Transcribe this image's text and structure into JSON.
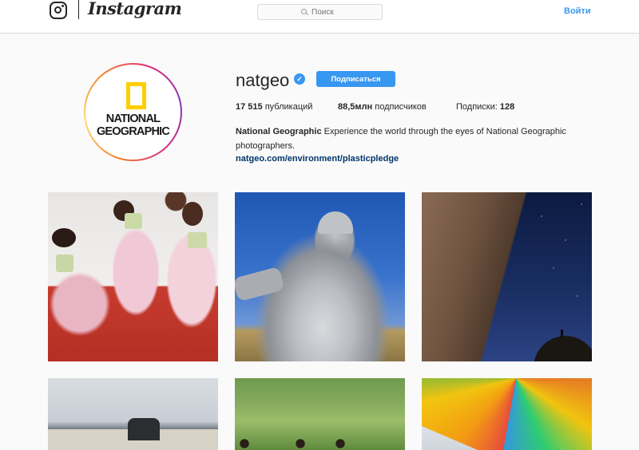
{
  "header": {
    "wordmark": "Instagram",
    "search_placeholder": "Поиск",
    "login_label": "Войти"
  },
  "profile": {
    "username": "natgeo",
    "verified_glyph": "✓",
    "follow_label": "Подписаться",
    "logo_line1": "NATIONAL",
    "logo_line2": "GEOGRAPHIC",
    "stats": {
      "posts_count": "17 515",
      "posts_label": " публикаций",
      "followers_count": "88,5млн",
      "followers_label": " подписчиков",
      "following_label": "Подписки: ",
      "following_count": "128"
    },
    "bio_name": "National Geographic",
    "bio_text": " Experience the world through the eyes of National Geographic photographers.",
    "bio_link": "natgeo.com/environment/plasticpledge"
  },
  "colors": {
    "accent": "#3897f0",
    "link": "#003569",
    "ng_yellow": "#ffce00"
  },
  "icons": [
    "instagram-glyph-icon",
    "search-icon",
    "verified-badge-icon"
  ]
}
